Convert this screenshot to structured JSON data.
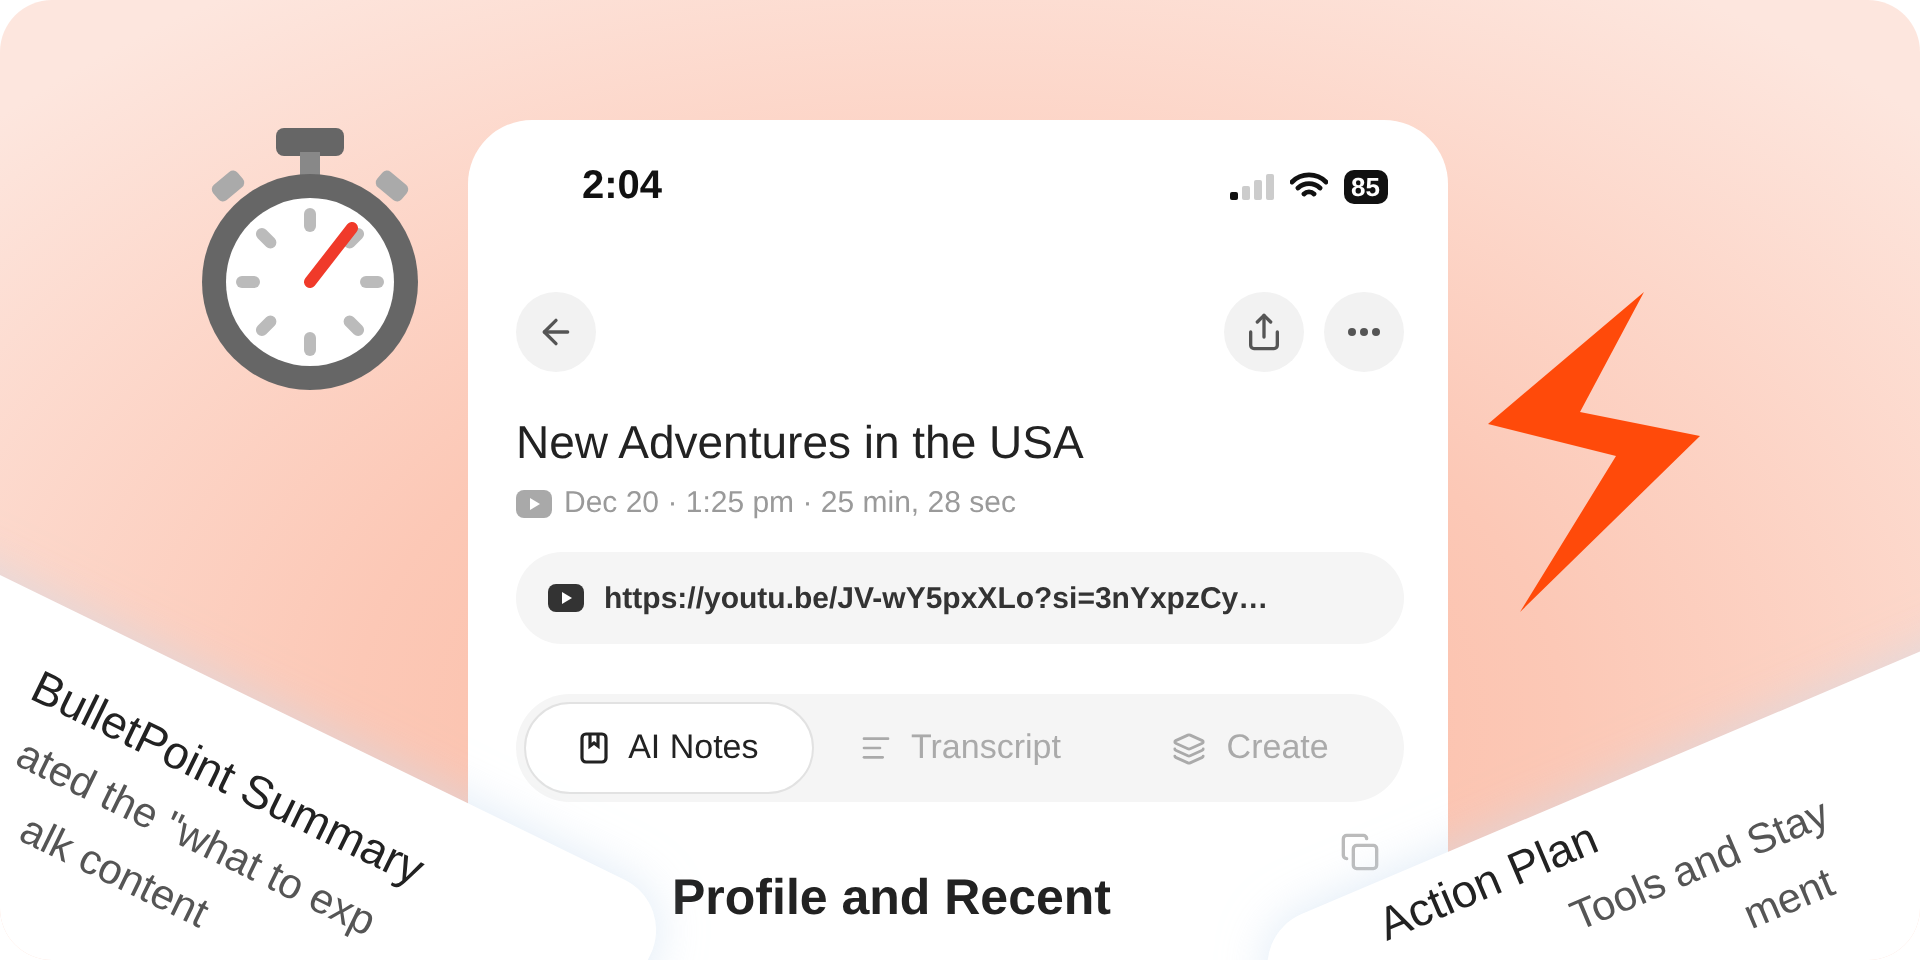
{
  "status_bar": {
    "time": "2:04",
    "battery": "85"
  },
  "header": {
    "title": "New Adventures in the USA",
    "meta": "Dec 20 · 1:25 pm · 25 min, 28 sec"
  },
  "link": {
    "url": "https://youtu.be/JV-wY5pxXLo?si=3nYxpzCy…"
  },
  "tabs": [
    {
      "label": "AI Notes",
      "selected": true,
      "kind": "notes"
    },
    {
      "label": "Transcript",
      "selected": false,
      "kind": "transcript"
    },
    {
      "label": "Create",
      "selected": false,
      "kind": "create"
    }
  ],
  "section": {
    "heading": "Profile and Recent"
  },
  "overlay_cards": [
    {
      "title": "BulletPoint Summary",
      "lines": [
        "ated the \"what to exp",
        "alk content"
      ]
    },
    {
      "title": "Action Plan",
      "lines": [
        "Tools and Stay",
        "ment"
      ]
    }
  ]
}
